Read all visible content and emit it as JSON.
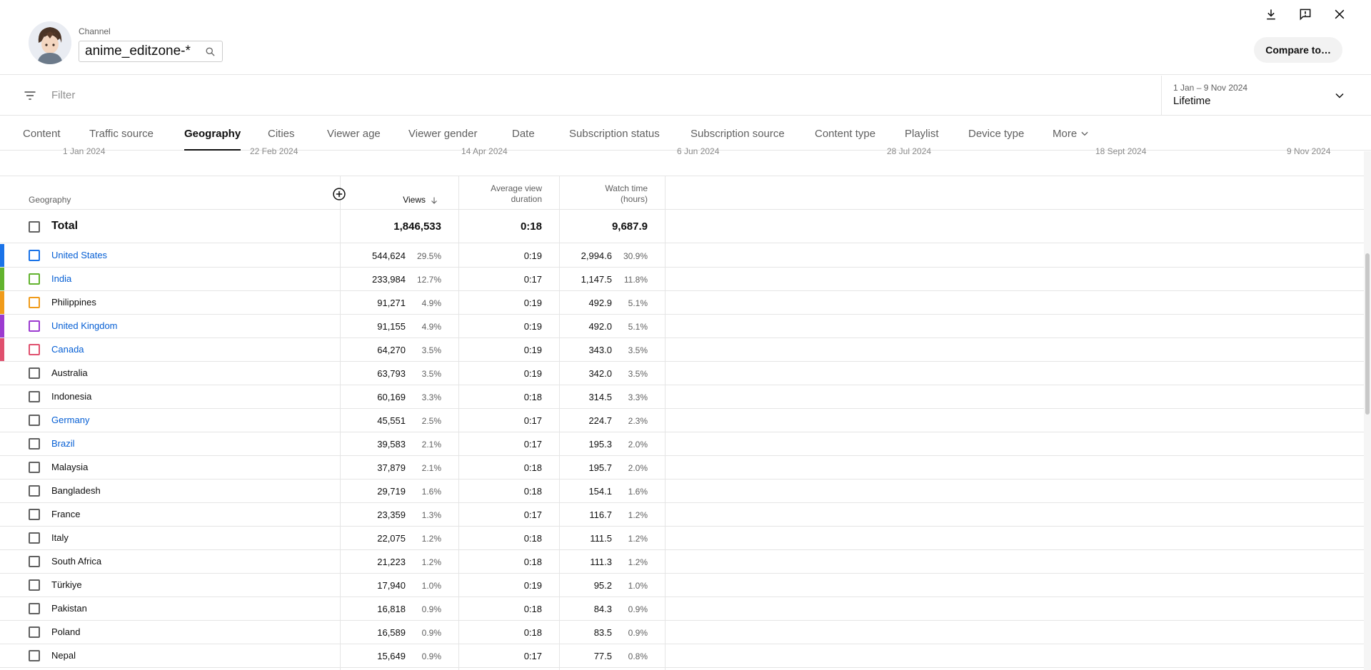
{
  "header": {
    "channel_label": "Channel",
    "channel_name": "anime_editzone-*",
    "compare_label": "Compare to…"
  },
  "filter": {
    "placeholder": "Filter",
    "date_range": "1 Jan – 9 Nov 2024",
    "period": "Lifetime"
  },
  "tabs": [
    {
      "label": "Content"
    },
    {
      "label": "Traffic source"
    },
    {
      "label": "Geography"
    },
    {
      "label": "Cities"
    },
    {
      "label": "Viewer age"
    },
    {
      "label": "Viewer gender"
    },
    {
      "label": "Date"
    },
    {
      "label": "Subscription status"
    },
    {
      "label": "Subscription source"
    },
    {
      "label": "Content type"
    },
    {
      "label": "Playlist"
    },
    {
      "label": "Device type"
    },
    {
      "label": "More"
    }
  ],
  "chart_axis": [
    "1 Jan 2024",
    "22 Feb 2024",
    "14 Apr 2024",
    "6 Jun 2024",
    "28 Jul 2024",
    "18 Sept 2024",
    "9 Nov 2024"
  ],
  "table": {
    "headers": {
      "geography": "Geography",
      "views": "Views",
      "avg_view_duration_1": "Average view",
      "avg_view_duration_2": "duration",
      "watch_time_1": "Watch time",
      "watch_time_2": "(hours)"
    },
    "total": {
      "label": "Total",
      "views": "1,846,533",
      "avg": "0:18",
      "watch": "9,687.9"
    },
    "rows": [
      {
        "name": "United States",
        "views": "544,624",
        "views_pct": "29.5%",
        "avg": "0:19",
        "watch": "2,994.6",
        "watch_pct": "30.9%",
        "color": "#1a73e8",
        "link": true
      },
      {
        "name": "India",
        "views": "233,984",
        "views_pct": "12.7%",
        "avg": "0:17",
        "watch": "1,147.5",
        "watch_pct": "11.8%",
        "color": "#62b32e",
        "link": true
      },
      {
        "name": "Philippines",
        "views": "91,271",
        "views_pct": "4.9%",
        "avg": "0:19",
        "watch": "492.9",
        "watch_pct": "5.1%",
        "color": "#f09b1a",
        "link": false
      },
      {
        "name": "United Kingdom",
        "views": "91,155",
        "views_pct": "4.9%",
        "avg": "0:19",
        "watch": "492.0",
        "watch_pct": "5.1%",
        "color": "#9c3bd0",
        "link": true
      },
      {
        "name": "Canada",
        "views": "64,270",
        "views_pct": "3.5%",
        "avg": "0:19",
        "watch": "343.0",
        "watch_pct": "3.5%",
        "color": "#e0506e",
        "link": true
      },
      {
        "name": "Australia",
        "views": "63,793",
        "views_pct": "3.5%",
        "avg": "0:19",
        "watch": "342.0",
        "watch_pct": "3.5%",
        "color": "",
        "link": false
      },
      {
        "name": "Indonesia",
        "views": "60,169",
        "views_pct": "3.3%",
        "avg": "0:18",
        "watch": "314.5",
        "watch_pct": "3.3%",
        "color": "",
        "link": false
      },
      {
        "name": "Germany",
        "views": "45,551",
        "views_pct": "2.5%",
        "avg": "0:17",
        "watch": "224.7",
        "watch_pct": "2.3%",
        "color": "",
        "link": true
      },
      {
        "name": "Brazil",
        "views": "39,583",
        "views_pct": "2.1%",
        "avg": "0:17",
        "watch": "195.3",
        "watch_pct": "2.0%",
        "color": "",
        "link": true
      },
      {
        "name": "Malaysia",
        "views": "37,879",
        "views_pct": "2.1%",
        "avg": "0:18",
        "watch": "195.7",
        "watch_pct": "2.0%",
        "color": "",
        "link": false
      },
      {
        "name": "Bangladesh",
        "views": "29,719",
        "views_pct": "1.6%",
        "avg": "0:18",
        "watch": "154.1",
        "watch_pct": "1.6%",
        "color": "",
        "link": false
      },
      {
        "name": "France",
        "views": "23,359",
        "views_pct": "1.3%",
        "avg": "0:17",
        "watch": "116.7",
        "watch_pct": "1.2%",
        "color": "",
        "link": false
      },
      {
        "name": "Italy",
        "views": "22,075",
        "views_pct": "1.2%",
        "avg": "0:18",
        "watch": "111.5",
        "watch_pct": "1.2%",
        "color": "",
        "link": false
      },
      {
        "name": "South Africa",
        "views": "21,223",
        "views_pct": "1.2%",
        "avg": "0:18",
        "watch": "111.3",
        "watch_pct": "1.2%",
        "color": "",
        "link": false
      },
      {
        "name": "Türkiye",
        "views": "17,940",
        "views_pct": "1.0%",
        "avg": "0:19",
        "watch": "95.2",
        "watch_pct": "1.0%",
        "color": "",
        "link": false
      },
      {
        "name": "Pakistan",
        "views": "16,818",
        "views_pct": "0.9%",
        "avg": "0:18",
        "watch": "84.3",
        "watch_pct": "0.9%",
        "color": "",
        "link": false
      },
      {
        "name": "Poland",
        "views": "16,589",
        "views_pct": "0.9%",
        "avg": "0:18",
        "watch": "83.5",
        "watch_pct": "0.9%",
        "color": "",
        "link": false
      },
      {
        "name": "Nepal",
        "views": "15,649",
        "views_pct": "0.9%",
        "avg": "0:17",
        "watch": "77.5",
        "watch_pct": "0.8%",
        "color": "",
        "link": false
      }
    ]
  }
}
